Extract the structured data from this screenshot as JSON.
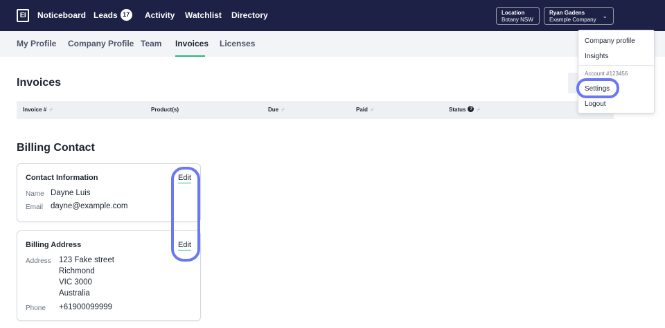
{
  "topbar": {
    "logo_text": "EI",
    "nav": [
      {
        "label": "Noticeboard"
      },
      {
        "label": "Leads",
        "badge": "17"
      },
      {
        "label": "Activity"
      },
      {
        "label": "Watchlist"
      },
      {
        "label": "Directory"
      }
    ],
    "location": {
      "label": "Location",
      "value": "Botany NSW"
    },
    "account": {
      "name": "Ryan Gadens",
      "company": "Example Company",
      "chevron": "⌄"
    }
  },
  "tabs": [
    {
      "label": "My Profile"
    },
    {
      "label": "Company Profile"
    },
    {
      "label": "Team"
    },
    {
      "label": "Invoices",
      "active": true
    },
    {
      "label": "Licenses"
    }
  ],
  "invoices": {
    "title": "Invoices",
    "columns": [
      "Invoice #",
      "Product(s)",
      "Due",
      "Paid",
      "Status"
    ],
    "sort_glyph": "⌿",
    "help_glyph": "?"
  },
  "billing": {
    "title": "Billing Contact",
    "contact": {
      "title": "Contact Information",
      "edit": "Edit",
      "name_label": "Name",
      "name": "Dayne Luis",
      "email_label": "Email",
      "email": "dayne@example.com"
    },
    "address": {
      "title": "Billing Address",
      "edit": "Edit",
      "address_label": "Address",
      "lines": [
        "123 Fake street",
        "Richmond",
        "VIC 3000",
        "Australia"
      ],
      "phone_label": "Phone",
      "phone": "+61900099999"
    }
  },
  "dropdown": {
    "items": [
      "Company profile",
      "Insights"
    ],
    "account": "Account #123456",
    "settings": "Settings",
    "logout": "Logout"
  },
  "colors": {
    "nav_bg": "#1c2145",
    "accent_green": "#2db37a",
    "highlight_ring": "#6b78f5"
  }
}
